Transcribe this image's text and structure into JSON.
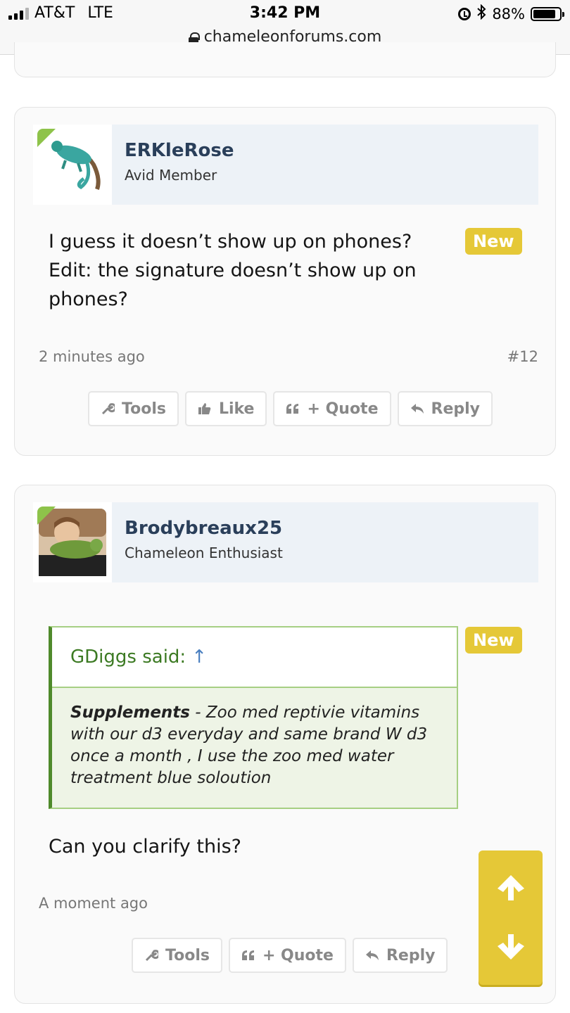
{
  "status_bar": {
    "carrier": "AT&T",
    "network": "LTE",
    "time": "3:42 PM",
    "battery": "88%",
    "battery_level": 0.88,
    "icons": [
      "signal-icon",
      "alarm-icon",
      "bluetooth-icon",
      "battery-icon"
    ]
  },
  "browser": {
    "url": "chameleonforums.com"
  },
  "posts": [
    {
      "username": "ERKleRose",
      "user_title": "Avid Member",
      "badge": "New",
      "body": "I guess it doesn’t show up on phones? Edit: the signature doesn’t show up on phones?",
      "time": "2 minutes ago",
      "post_number": "#12",
      "actions": [
        "Tools",
        "Like",
        "+ Quote",
        "Reply"
      ]
    },
    {
      "username": "Brodybreaux25",
      "user_title": "Chameleon Enthusiast",
      "badge": "New",
      "quote": {
        "author": "GDiggs said:",
        "arrow": "↑",
        "bold_lead": "Supplements",
        "text": " - Zoo med reptivie vitamins with our d3 everyday and same brand W d3 once a month , I use the zoo med water treatment blue soloution"
      },
      "body": "Can you clarify this?",
      "time": "A moment ago",
      "actions": [
        "Tools",
        "+ Quote",
        "Reply"
      ]
    }
  ],
  "colors": {
    "badge": "#e5c837",
    "username": "#2a3f5a",
    "quote_border": "#4f8a2b",
    "quote_bg": "#eef4e6",
    "user_head_bg": "#edf2f7"
  }
}
